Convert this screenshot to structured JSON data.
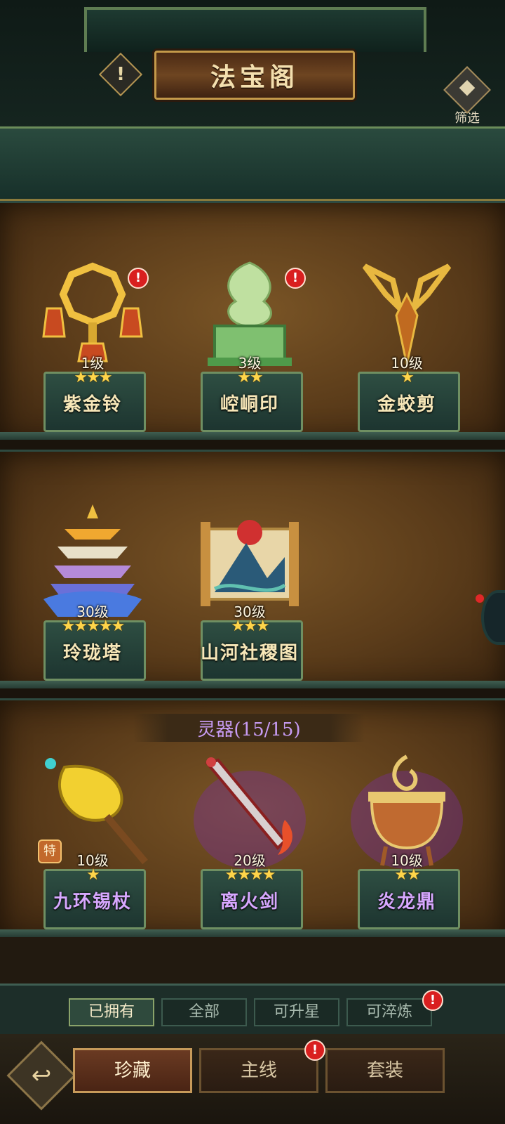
{
  "header": {
    "title": "法宝阁",
    "warning_icon_text": "!",
    "filter_label": "筛选"
  },
  "shelves": [
    {
      "items": [
        {
          "name": "紫金铃",
          "level": "1级",
          "stars": 3,
          "has_alert": true,
          "alert": "!",
          "name_color": "gold"
        },
        {
          "name": "崆峒印",
          "level": "3级",
          "stars": 2,
          "has_alert": true,
          "alert": "!",
          "name_color": "gold"
        },
        {
          "name": "金蛟剪",
          "level": "10级",
          "stars": 1,
          "has_alert": false,
          "alert": "",
          "name_color": "gold"
        }
      ]
    },
    {
      "items": [
        {
          "name": "玲珑塔",
          "level": "30级",
          "stars": 5,
          "has_alert": false,
          "alert": "",
          "name_color": "gold"
        },
        {
          "name": "山河社稷图",
          "level": "30级",
          "stars": 3,
          "has_alert": false,
          "alert": "",
          "name_color": "gold"
        }
      ]
    },
    {
      "section_title": "灵器(15/15)",
      "items": [
        {
          "name": "九环锡杖",
          "level": "10级",
          "stars": 1,
          "has_alert": false,
          "alert": "",
          "tag": "特",
          "name_color": "purple"
        },
        {
          "name": "离火剑",
          "level": "20级",
          "stars": 4,
          "has_alert": false,
          "alert": "",
          "name_color": "purple"
        },
        {
          "name": "炎龙鼎",
          "level": "10级",
          "stars": 2,
          "has_alert": false,
          "alert": "",
          "name_color": "purple"
        }
      ]
    }
  ],
  "filter_tabs": [
    {
      "label": "已拥有",
      "active": true,
      "alert": ""
    },
    {
      "label": "全部",
      "active": false,
      "alert": ""
    },
    {
      "label": "可升星",
      "active": false,
      "alert": ""
    },
    {
      "label": "可淬炼",
      "active": false,
      "alert": "!"
    }
  ],
  "bottom_nav": {
    "back_icon": "↩",
    "tabs": [
      {
        "label": "珍藏",
        "active": true,
        "alert": ""
      },
      {
        "label": "主线",
        "active": false,
        "alert": "!"
      },
      {
        "label": "套装",
        "active": false,
        "alert": ""
      }
    ]
  },
  "colors": {
    "gold_text": "#f7e7b8",
    "purple_text": "#d7a7ff",
    "star": "#ffd54a",
    "alert_red": "#d91f1f"
  }
}
